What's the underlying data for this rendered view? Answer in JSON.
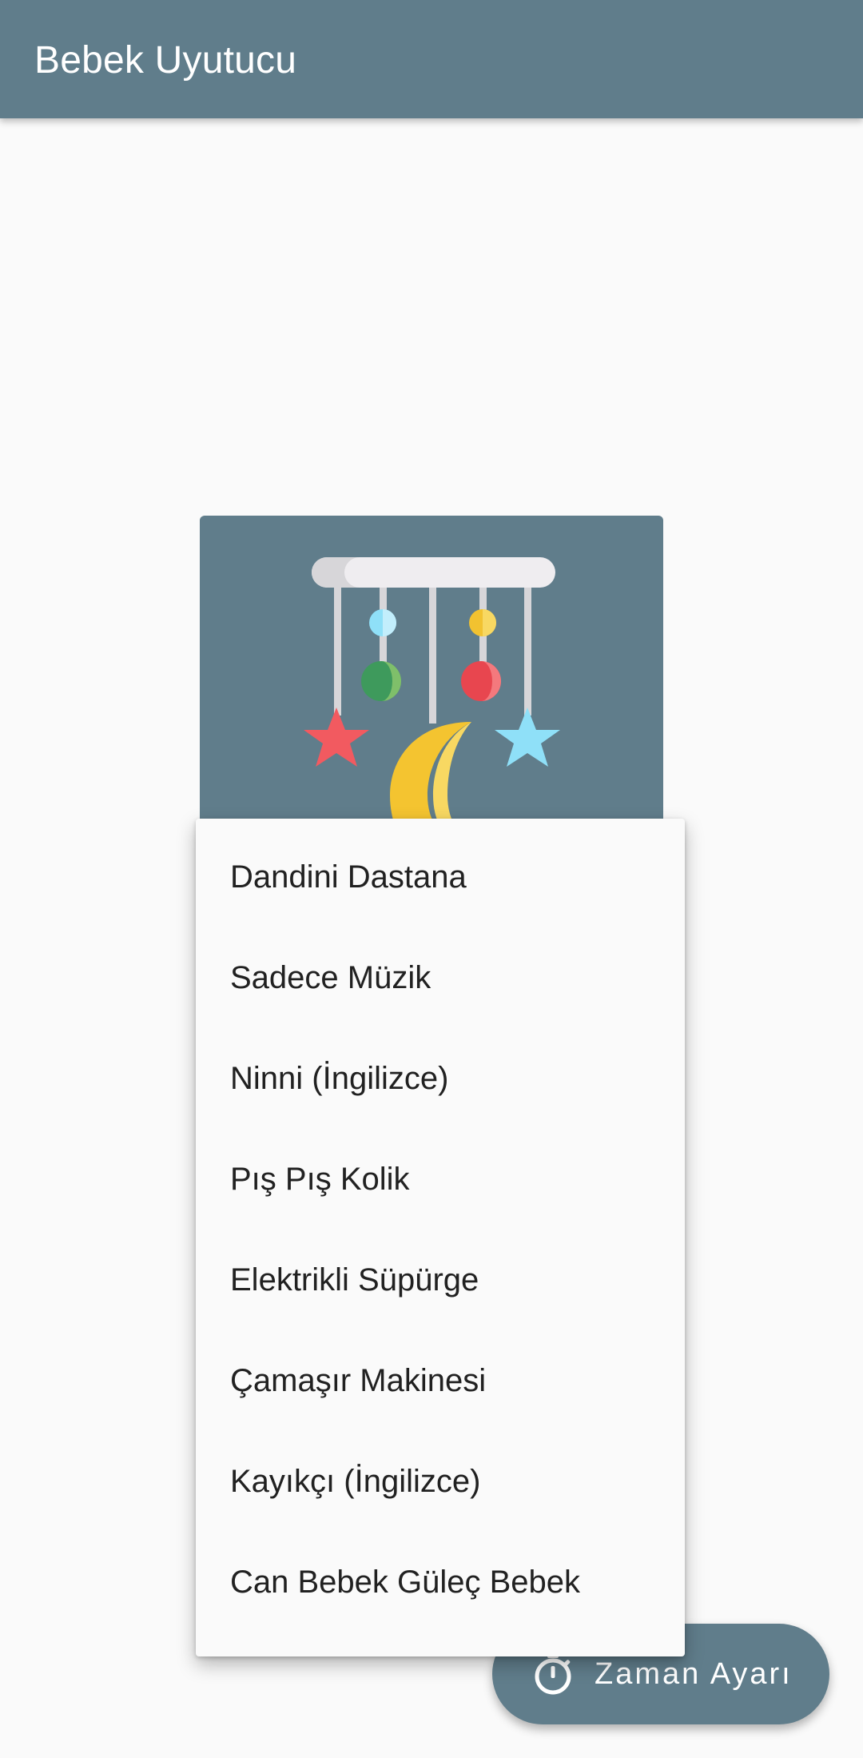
{
  "app_bar": {
    "title": "Bebek Uyutucu"
  },
  "image": {
    "icon": "baby-crib-mobile-icon"
  },
  "menu": {
    "items": [
      {
        "label": "Dandini Dastana"
      },
      {
        "label": "Sadece Müzik"
      },
      {
        "label": "Ninni (İngilizce)"
      },
      {
        "label": "Pış Pış Kolik"
      },
      {
        "label": "Elektrikli Süpürge"
      },
      {
        "label": "Çamaşır Makinesi"
      },
      {
        "label": "Kayıkçı (İngilizce)"
      },
      {
        "label": "Can Bebek Güleç Bebek"
      }
    ]
  },
  "fab": {
    "label": "Zaman Ayarı",
    "icon": "timer-icon"
  },
  "colors": {
    "primary": "#607d8b",
    "background": "#fafafa",
    "text": "#212121"
  }
}
